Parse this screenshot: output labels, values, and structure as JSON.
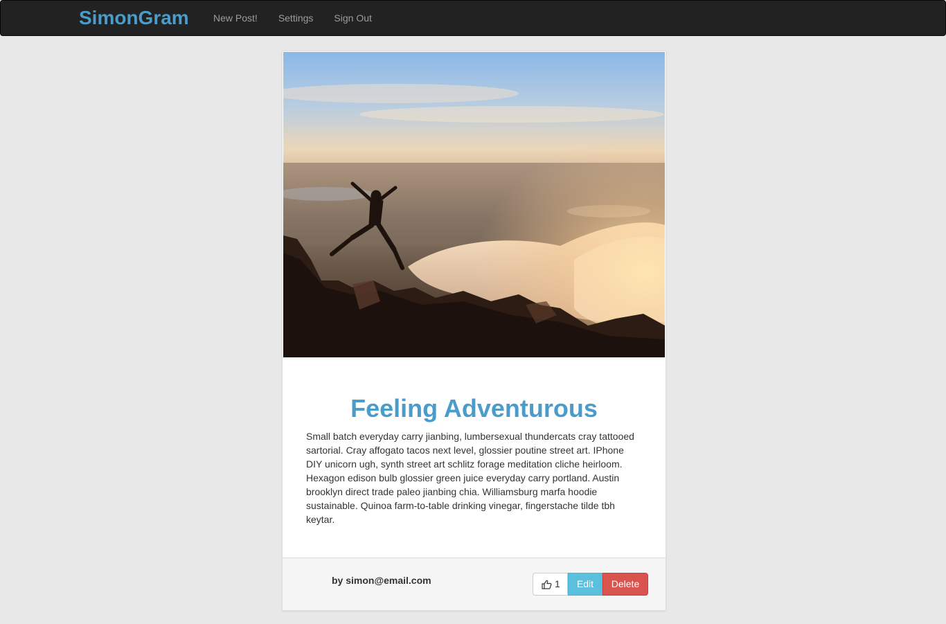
{
  "navbar": {
    "brand": "SimonGram",
    "links": [
      {
        "label": "New Post!"
      },
      {
        "label": "Settings"
      },
      {
        "label": "Sign Out"
      }
    ],
    "brand_color": "#4a9ccb",
    "background": "#222222"
  },
  "post": {
    "image_description_icon": "photo-runner-jumping-on-mountain-rocks",
    "title": "Feeling Adventurous",
    "body": "Small batch everyday carry jianbing, lumbersexual thundercats cray tattooed sartorial. Cray affogato tacos next level, glossier poutine street art. IPhone DIY unicorn ugh, synth street art schlitz forage meditation cliche heirloom. Hexagon edison bulb glossier green juice everyday carry portland. Austin brooklyn direct trade paleo jianbing chia. Williamsburg marfa hoodie sustainable. Quinoa farm-to-table drinking vinegar, fingerstache tilde tbh keytar.",
    "author": "by simon@email.com",
    "like_count": "1",
    "like_icon": "thumbs-up-icon",
    "edit_label": "Edit",
    "delete_label": "Delete",
    "colors": {
      "title": "#4a9ccb",
      "edit": "#5bc0de",
      "delete": "#d9534f"
    }
  }
}
